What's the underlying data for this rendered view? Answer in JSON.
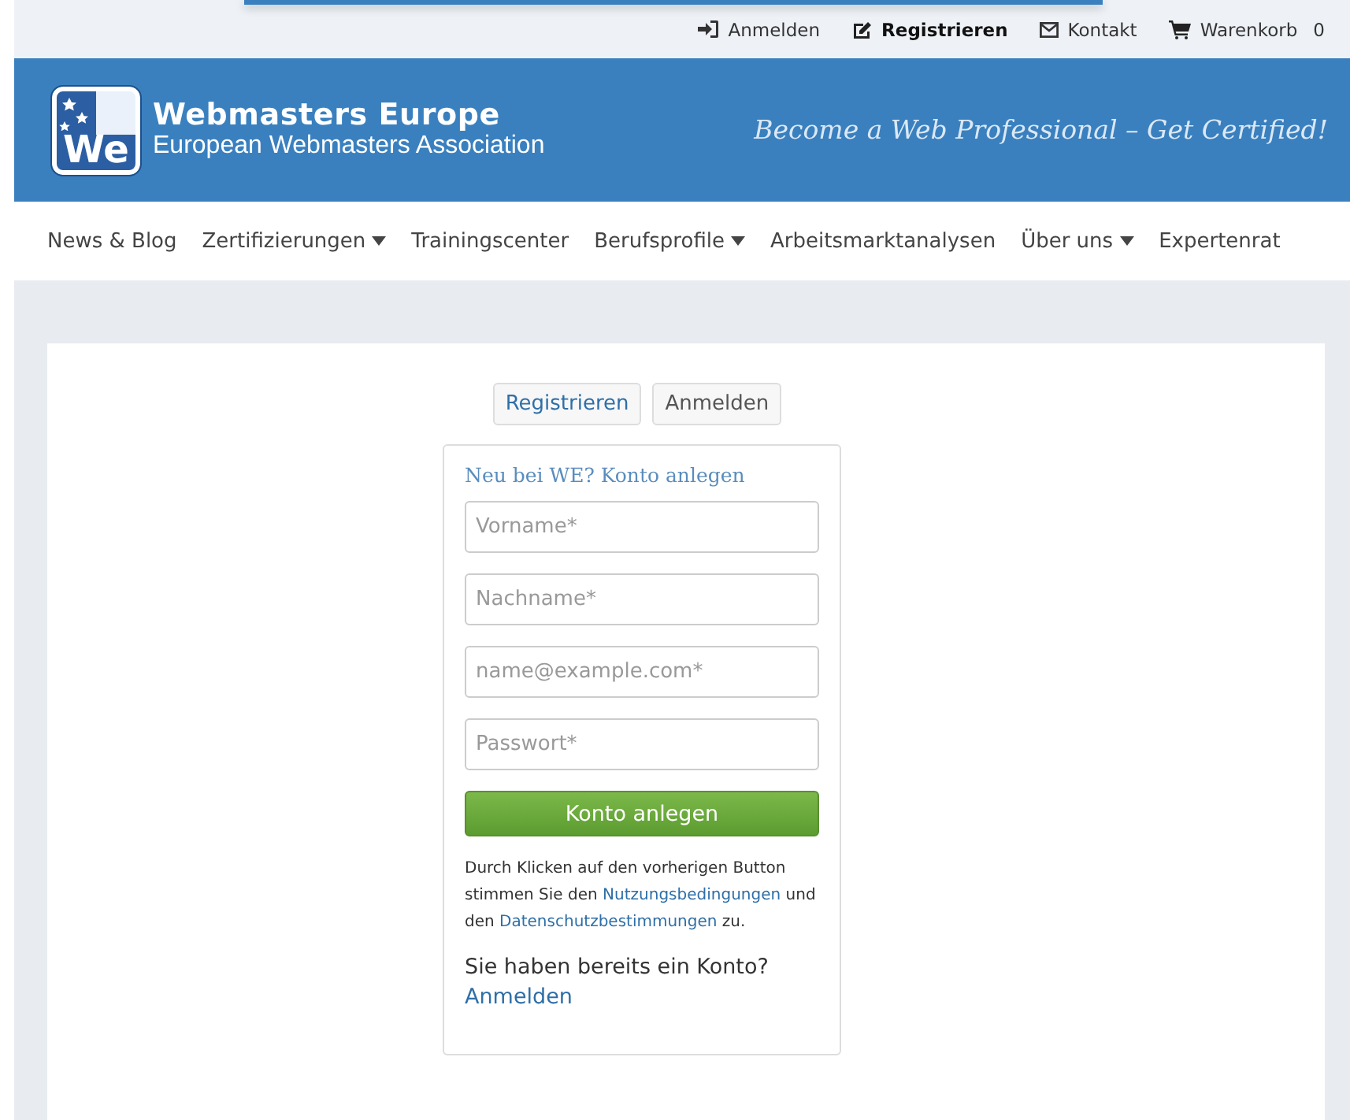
{
  "top_links": [
    {
      "kind": "login",
      "label": "Anmelden",
      "selected": false
    },
    {
      "kind": "register",
      "label": "Registrieren",
      "selected": true
    },
    {
      "kind": "contact",
      "label": "Kontakt",
      "selected": false
    },
    {
      "kind": "cart",
      "label": "Warenkorb",
      "count": "0",
      "selected": false
    }
  ],
  "header": {
    "logo_mark": "We",
    "brand": "Webmasters Europe",
    "subtitle": "European Webmasters Association",
    "tagline": "Become a Web Professional – Get Certified!"
  },
  "nav": [
    {
      "label": "News & Blog",
      "has_menu": false
    },
    {
      "label": "Zertifizierungen",
      "has_menu": true
    },
    {
      "label": "Trainingscenter",
      "has_menu": false
    },
    {
      "label": "Berufsprofile",
      "has_menu": true
    },
    {
      "label": "Arbeitsmarktanalysen",
      "has_menu": false
    },
    {
      "label": "Über uns",
      "has_menu": true
    },
    {
      "label": "Expertenrat",
      "has_menu": false
    }
  ],
  "tabs": [
    {
      "label": "Registrieren",
      "selected": true
    },
    {
      "label": "Anmelden",
      "selected": false
    }
  ],
  "form": {
    "title": "Neu bei WE? Konto anlegen",
    "fields": [
      {
        "placeholder": "Vorname*"
      },
      {
        "placeholder": "Nachname*"
      },
      {
        "placeholder": "name@example.com*"
      },
      {
        "placeholder": "Passwort*"
      }
    ],
    "submit": "Konto anlegen",
    "terms": {
      "before": "Durch Klicken auf den vorherigen Button stimmen Sie den",
      "link_1": "Nutzungsbedingungen",
      "middle": "und den",
      "link_2": "Datenschutzbestimmungen",
      "after": "zu."
    },
    "login_prompt": "Sie haben bereits ein Konto?",
    "login_link": "Anmelden"
  }
}
